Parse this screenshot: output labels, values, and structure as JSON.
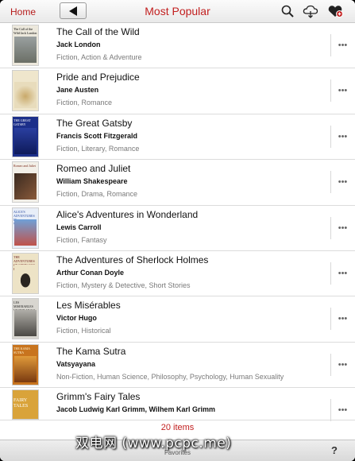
{
  "nav": {
    "home_label": "Home",
    "title": "Most Popular",
    "icons": [
      "back-arrow-icon",
      "search-icon",
      "cloud-icon",
      "favorite-icon"
    ],
    "accent_color": "#c21f1f"
  },
  "books": [
    {
      "title": "The Call of the Wild",
      "author": "Jack London",
      "genres": "Fiction, Action & Adventure",
      "cover_text": "The Call of the Wild Jack London",
      "cover_color": "#b9b39d"
    },
    {
      "title": "Pride and Prejudice",
      "author": "Jane Austen",
      "genres": "Fiction, Romance",
      "cover_text": "",
      "cover_color": "#d9c89a"
    },
    {
      "title": "The Great Gatsby",
      "author": "Francis Scott Fitzgerald",
      "genres": "Fiction, Literary, Romance",
      "cover_text": "THE GREAT GATSBY",
      "cover_color": "#1c2f8a"
    },
    {
      "title": "Romeo and Juliet",
      "author": "William Shakespeare",
      "genres": "Fiction, Drama, Romance",
      "cover_text": "Romeo and Juliet",
      "cover_color": "#6b3a2a"
    },
    {
      "title": "Alice's Adventures in Wonderland",
      "author": "Lewis Carroll",
      "genres": "Fiction, Fantasy",
      "cover_text": "ALICE'S ADVENTURES IN WONDERLAND",
      "cover_color": "#3a66c0"
    },
    {
      "title": "The Adventures of Sherlock Holmes",
      "author": "Arthur Conan Doyle",
      "genres": "Fiction, Mystery & Detective, Short Stories",
      "cover_text": "THE ADVENTURES OF SHERLOCK HOLMES",
      "cover_color": "#e7dcc0"
    },
    {
      "title": "Les Misérables",
      "author": "Victor Hugo",
      "genres": "Fiction, Historical",
      "cover_text": "LES MISERABLES VICTOR HUGO",
      "cover_color": "#5a5a5a"
    },
    {
      "title": "The Kama Sutra",
      "author": "Vatsyayana",
      "genres": "Non-Fiction, Human Science, Philosophy, Psychology, Human Sexuality",
      "cover_text": "THE KAMA SUTRA",
      "cover_color": "#b8681c"
    },
    {
      "title": "Grimm's Fairy Tales",
      "author": "Jacob Ludwig Karl Grimm, Wilhem Karl Grimm",
      "genres": "",
      "cover_text": "FAIRY TALES",
      "cover_color": "#c9932a"
    }
  ],
  "footer": {
    "items_count": "20 items",
    "favorites_label": "Favorites",
    "help_label": "?"
  },
  "watermark": "双电网 (www.pcpc.me)"
}
